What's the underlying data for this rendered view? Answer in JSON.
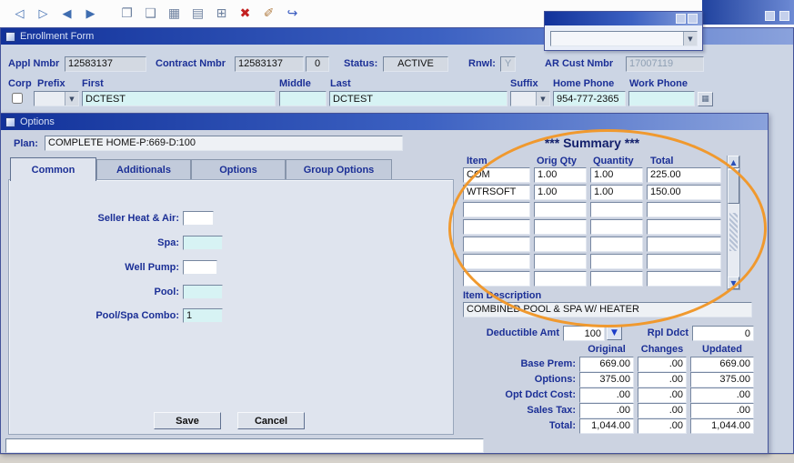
{
  "toolbar": {
    "icons": [
      {
        "name": "previous-record",
        "glyph": "◁"
      },
      {
        "name": "next-record",
        "glyph": "▷"
      },
      {
        "name": "previous-block",
        "glyph": "◀"
      },
      {
        "name": "next-block",
        "glyph": "▶"
      },
      {
        "name": "duplicate-field",
        "glyph": "❐"
      },
      {
        "name": "duplicate-record",
        "glyph": "❑"
      },
      {
        "name": "list-of-values",
        "glyph": "▦"
      },
      {
        "name": "print",
        "glyph": "▤"
      },
      {
        "name": "tree-view",
        "glyph": "⊞"
      },
      {
        "name": "delete-record",
        "glyph": "✖"
      },
      {
        "name": "clear-record",
        "glyph": "✐"
      },
      {
        "name": "exit",
        "glyph": "↪"
      }
    ]
  },
  "popup": {
    "title": ""
  },
  "enrollment": {
    "title": "Enrollment Form",
    "appl_nmbr_label": "Appl Nmbr",
    "appl_nmbr": "12583137",
    "contract_nmbr_label": "Contract Nmbr",
    "contract_nmbr": "12583137",
    "contract_seq": "0",
    "status_label": "Status:",
    "status": "ACTIVE",
    "rnwl_label": "Rnwl:",
    "rnwl": "Y",
    "ar_cust_label": "AR Cust Nmbr",
    "ar_cust": "17007119",
    "corp_label": "Corp",
    "prefix_label": "Prefix",
    "first_label": "First",
    "first": "DCTEST",
    "middle_label": "Middle",
    "middle": "",
    "last_label": "Last",
    "last": "DCTEST",
    "suffix_label": "Suffix",
    "home_phone_label": "Home Phone",
    "home_phone": "954-777-2365",
    "work_phone_label": "Work Phone",
    "work_phone": ""
  },
  "options": {
    "title": "Options",
    "plan_label": "Plan:",
    "plan": "COMPLETE HOME-P:669-D:100",
    "tabs": [
      "Common",
      "Additionals",
      "Options",
      "Group Options"
    ],
    "fields": [
      {
        "label": "Seller Heat & Air:",
        "value": ""
      },
      {
        "label": "Spa:",
        "value": ""
      },
      {
        "label": "Well Pump:",
        "value": ""
      },
      {
        "label": "Pool:",
        "value": ""
      },
      {
        "label": "Pool/Spa Combo:",
        "value": "1"
      }
    ],
    "save_label": "Save",
    "cancel_label": "Cancel",
    "status_message": ""
  },
  "summary": {
    "title": "*** Summary ***",
    "headers": [
      "Item",
      "Orig Qty",
      "Quantity",
      "Total"
    ],
    "rows": [
      [
        "COM",
        "1.00",
        "1.00",
        "225.00"
      ],
      [
        "WTRSOFT",
        "1.00",
        "1.00",
        "150.00"
      ],
      [
        "",
        "",
        "",
        ""
      ],
      [
        "",
        "",
        "",
        ""
      ],
      [
        "",
        "",
        "",
        ""
      ],
      [
        "",
        "",
        "",
        ""
      ],
      [
        "",
        "",
        "",
        ""
      ]
    ],
    "item_description_label": "Item Description",
    "item_description": "COMBINED POOL & SPA W/ HEATER"
  },
  "totals": {
    "deductible_label": "Deductible Amt",
    "deductible": "100",
    "rpl_ddct_label": "Rpl Ddct",
    "rpl_ddct": "0",
    "headers": [
      "Original",
      "Changes",
      "Updated"
    ],
    "rows": [
      {
        "label": "Base Prem:",
        "original": "669.00",
        "changes": ".00",
        "updated": "669.00"
      },
      {
        "label": "Options:",
        "original": "375.00",
        "changes": ".00",
        "updated": "375.00"
      },
      {
        "label": "Opt Ddct Cost:",
        "original": ".00",
        "changes": ".00",
        "updated": ".00"
      },
      {
        "label": "Sales Tax:",
        "original": ".00",
        "changes": ".00",
        "updated": ".00"
      },
      {
        "label": "Total:",
        "original": "1,044.00",
        "changes": ".00",
        "updated": "1,044.00"
      }
    ]
  },
  "colors": {
    "annotation_orange": "#f0992e",
    "titlebar_blue": "#12329a",
    "label_navy": "#1b2f96",
    "field_cyan": "#d7f3f4"
  }
}
